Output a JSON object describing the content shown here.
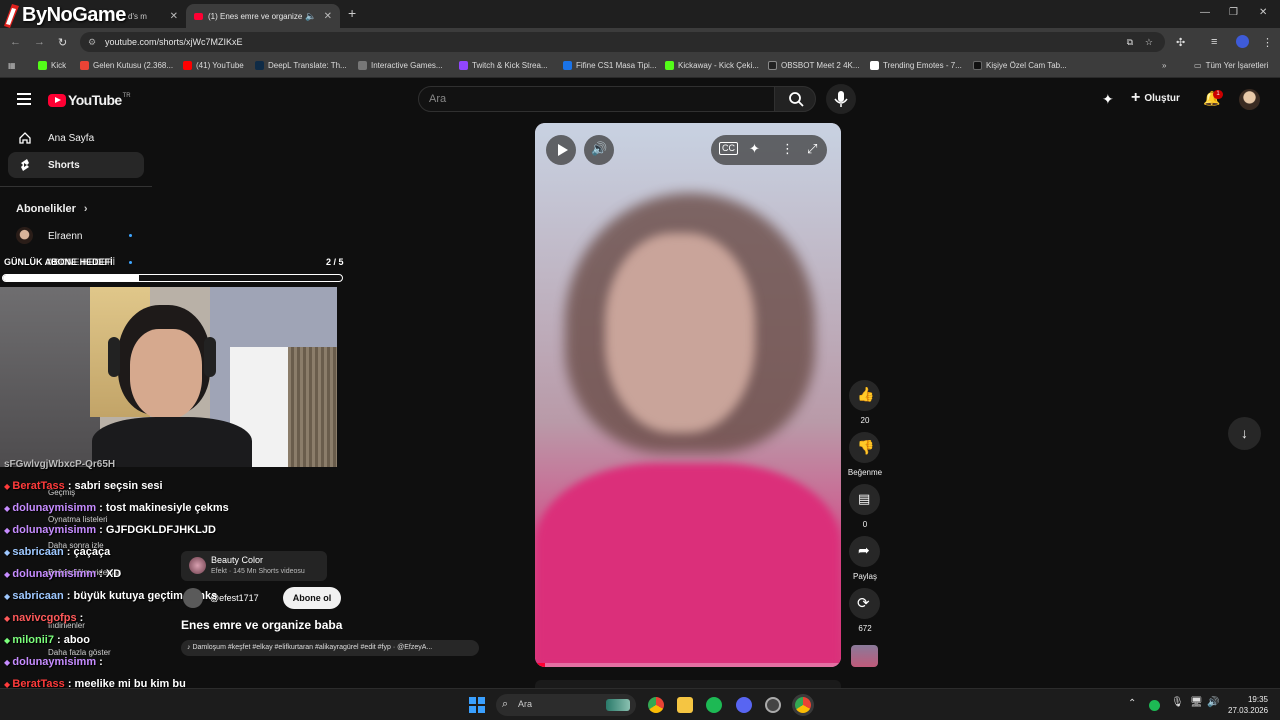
{
  "overlay_logo": "ByNoGame",
  "browser": {
    "tabs": [
      {
        "label": "d's m"
      },
      {
        "label": "(1) Enes emre ve organize"
      }
    ],
    "url": "youtube.com/shorts/xjWc7MZIKxE",
    "bookmarks": [
      {
        "label": "Kick",
        "color": "#53fc18"
      },
      {
        "label": "Gelen Kutusu (2.368...",
        "color": "#ea4335"
      },
      {
        "label": "(41) YouTube",
        "color": "#ff0000"
      },
      {
        "label": "DeepL Translate: Th...",
        "color": "#0f2b46"
      },
      {
        "label": "Interactive Games...",
        "color": "#777777"
      },
      {
        "label": "Twitch & Kick Strea...",
        "color": "#9146ff"
      },
      {
        "label": "Fifine CS1 Masa Tipi...",
        "color": "#1a73e8"
      },
      {
        "label": "Kickaway - Kick Çeki...",
        "color": "#53fc18"
      },
      {
        "label": "OBSBOT Meet 2 4K...",
        "color": "#222222"
      },
      {
        "label": "Trending Emotes - 7...",
        "color": "#ffffff"
      },
      {
        "label": "Kişiye Özel Cam Tab...",
        "color": "#111111"
      }
    ],
    "all_bookmarks": "Tüm Yer İşaretleri"
  },
  "youtube": {
    "logo": "YouTube",
    "country": "TR",
    "search_placeholder": "Ara",
    "create_label": "Oluştur",
    "notif_count": "1"
  },
  "sidebar": {
    "items": [
      {
        "label": "Ana Sayfa"
      },
      {
        "label": "Shorts"
      }
    ],
    "subs_heading": "Abonelikler",
    "subs": [
      {
        "label": "Elraenn"
      }
    ],
    "ghost_items": [
      "Geçmiş",
      "Oynatma listeleri",
      "Daha sonra izle",
      "Beğendiğim videolar",
      "İndirilenler",
      "Daha fazla göster"
    ]
  },
  "goal": {
    "label": "GÜNLÜK ABONE HEDEFİ",
    "label_overlap": "ABONE HEDEFİ",
    "count": "2 / 5",
    "progress": 0.4
  },
  "chat": {
    "top_fragment": "sFGwlvgjWbxcP-Qr65H",
    "messages": [
      {
        "user": "BeratTass",
        "color": "#ff3b3b",
        "text": ": sabri seçsin sesi"
      },
      {
        "user": "dolunaymisimm",
        "color": "#c68cff",
        "text": ": tost makinesiyle çekms"
      },
      {
        "user": "dolunaymisimm",
        "color": "#c68cff",
        "text": ": GJFDGKLDFJHKLJD"
      },
      {
        "user": "sabricaan",
        "color": "#9ec8ff",
        "text": ": çaçaça"
      },
      {
        "user": "dolunaymisimm",
        "color": "#c68cff",
        "text": ": XD"
      },
      {
        "user": "sabricaan",
        "color": "#9ec8ff",
        "text": ": büyük kutuya geçtim kanks"
      },
      {
        "user": "navivcgofps",
        "color": "#ff5a5a",
        "text": ":"
      },
      {
        "user": "milonii7",
        "color": "#7cff7c",
        "text": ": aboo"
      },
      {
        "user": "dolunaymisimm",
        "color": "#c68cff",
        "text": ":"
      },
      {
        "user": "BeratTass",
        "color": "#ff3b3b",
        "text": ": meelike mi bu kim bu"
      }
    ]
  },
  "short": {
    "effect_name": "Beauty Color",
    "effect_meta": "Efekt · 145 Mn Shorts videosu",
    "channel": "@efest1717",
    "subscribe": "Abone ol",
    "title": "Enes emre ve organize baba",
    "sound": "Damloşum #keşfet #elkay #elifkurtaran #alikayragürel #edit #fyp · @EfzeyA...",
    "like_count": "20",
    "dislike_label": "Beğenme",
    "comment_count": "0",
    "share_label": "Paylaş",
    "remix_count": "672"
  },
  "taskbar": {
    "search": "Ara",
    "time": "19:35",
    "date": "27.03.2026"
  }
}
